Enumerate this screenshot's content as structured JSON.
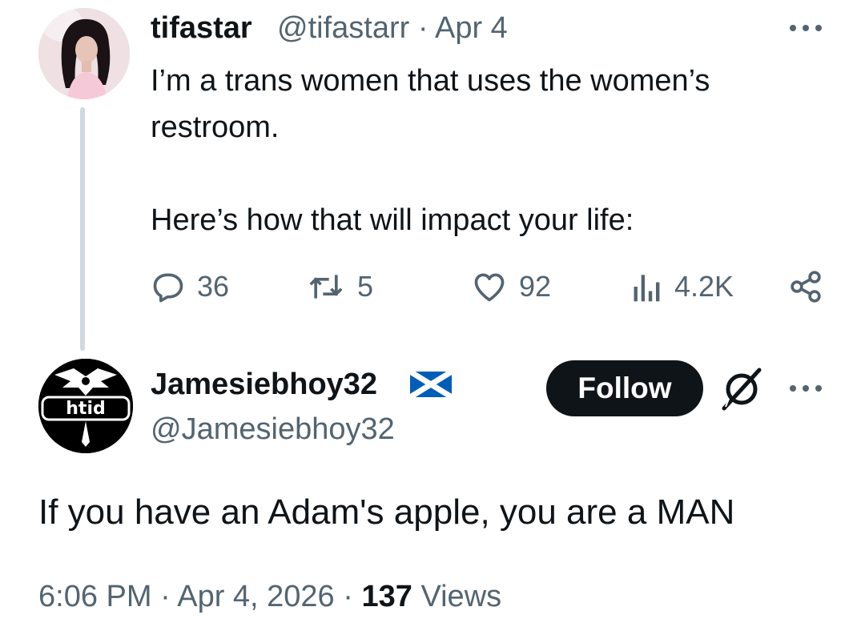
{
  "parent_tweet": {
    "display_name": "tifastar",
    "handle": "@tifastarr",
    "separator": "·",
    "date": "Apr 4",
    "paragraphs": [
      "I’m a trans women that uses the women’s restroom.",
      "Here’s how that will impact your life:"
    ],
    "actions": {
      "replies": "36",
      "reposts": "5",
      "likes": "92",
      "views": "4.2K"
    }
  },
  "reply_tweet": {
    "display_name": "Jamesiebhoy32",
    "handle": "@Jamesiebhoy32",
    "follow_label": "Follow",
    "avatar_text": "htid",
    "text": "If you have an Adam's apple, you are a MAN",
    "time": "6:06 PM",
    "separator": "·",
    "date": "Apr 4, 2026",
    "views_count": "137",
    "views_label": "Views"
  },
  "colors": {
    "text": "#0f1419",
    "secondary": "#536471",
    "thread_line": "#cfd9de",
    "follow_bg": "#0f1419",
    "flag_blue": "#005eb8"
  },
  "icons": [
    "more-icon",
    "reply-icon",
    "repost-icon",
    "like-icon",
    "views-icon",
    "share-icon",
    "grok-icon",
    "scotland-flag-icon"
  ]
}
